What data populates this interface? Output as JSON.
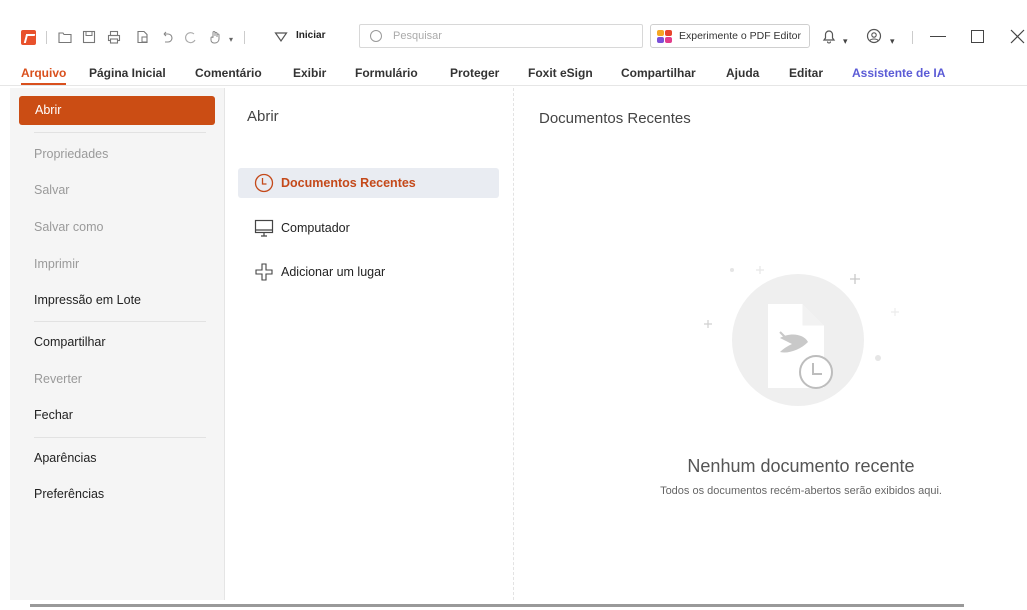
{
  "toolbar": {
    "iniciar_label": "Iniciar",
    "search_placeholder": "Pesquisar",
    "try_editor_label": "Experimente o PDF Editor"
  },
  "menu": {
    "items": [
      {
        "label": "Arquivo"
      },
      {
        "label": "Página Inicial"
      },
      {
        "label": "Comentário"
      },
      {
        "label": "Exibir"
      },
      {
        "label": "Formulário"
      },
      {
        "label": "Proteger"
      },
      {
        "label": "Foxit eSign"
      },
      {
        "label": "Compartilhar"
      },
      {
        "label": "Ajuda"
      },
      {
        "label": "Editar"
      },
      {
        "label": "Assistente de IA"
      }
    ]
  },
  "sidebar": {
    "items": [
      {
        "label": "Abrir"
      },
      {
        "label": "Propriedades"
      },
      {
        "label": "Salvar"
      },
      {
        "label": "Salvar como"
      },
      {
        "label": "Imprimir"
      },
      {
        "label": "Impressão em Lote"
      },
      {
        "label": "Compartilhar"
      },
      {
        "label": "Reverter"
      },
      {
        "label": "Fechar"
      },
      {
        "label": "Aparências"
      },
      {
        "label": "Preferências"
      }
    ]
  },
  "open_panel": {
    "title": "Abrir",
    "options": [
      {
        "label": "Documentos Recentes"
      },
      {
        "label": "Computador"
      },
      {
        "label": "Adicionar um lugar"
      }
    ]
  },
  "recent": {
    "title": "Documentos Recentes",
    "empty_title": "Nenhum documento recente",
    "empty_subtitle": "Todos os documentos recém-abertos serão exibidos aqui."
  },
  "colors": {
    "accent": "#cb4d14",
    "ai": "#5b5bd6"
  }
}
